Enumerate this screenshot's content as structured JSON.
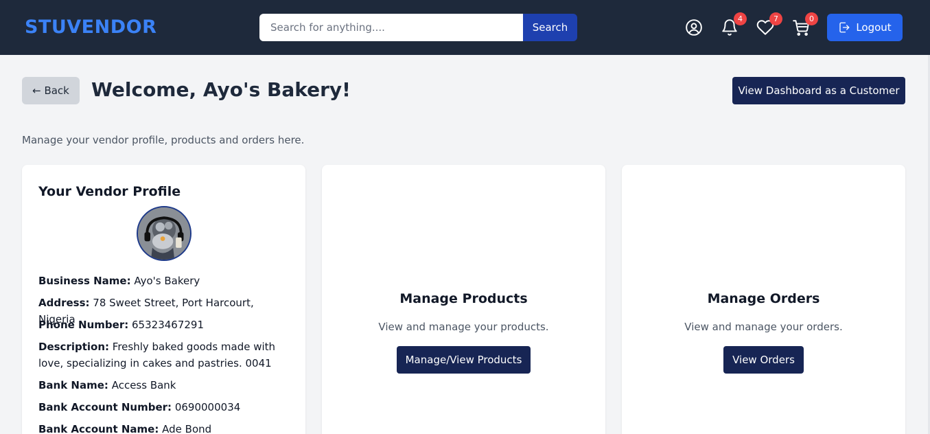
{
  "header": {
    "logo": "STUVENDOR",
    "search_placeholder": "Search for anything....",
    "search_button": "Search",
    "notifications_count": "4",
    "wishlist_count": "7",
    "cart_count": "0",
    "logout_label": "Logout",
    "icons": [
      "user-icon",
      "bell-icon",
      "heart-icon",
      "cart-icon",
      "logout-icon"
    ],
    "brand_color": "#3b82f6",
    "badge_color": "#ef4444"
  },
  "page": {
    "back_label": "← Back",
    "welcome": "Welcome, Ayo's Bakery!",
    "view_dashboard_label": "View Dashboard as a Customer",
    "subtitle": "Manage your vendor profile, products and orders here."
  },
  "profile": {
    "title": "Your Vendor Profile",
    "business_name_label": "Business Name:",
    "business_name": "Ayo's Bakery",
    "address_label": "Address:",
    "address": "78 Sweet Street, Port Harcourt, Nigeria",
    "phone_label": "Phone Number:",
    "phone": "65323467291",
    "description_label": "Description:",
    "description": "Freshly baked goods made with love, specializing in cakes and pastries. 0041",
    "bank_name_label": "Bank Name:",
    "bank_name": "Access Bank",
    "account_number_label": "Bank Account Number:",
    "account_number": "0690000034",
    "account_name_label": "Bank Account Name:",
    "account_name": "Ade Bond"
  },
  "products_card": {
    "title": "Manage Products",
    "description": "View and manage your products.",
    "button": "Manage/View Products"
  },
  "orders_card": {
    "title": "Manage Orders",
    "description": "View and manage your orders.",
    "button": "View Orders"
  }
}
